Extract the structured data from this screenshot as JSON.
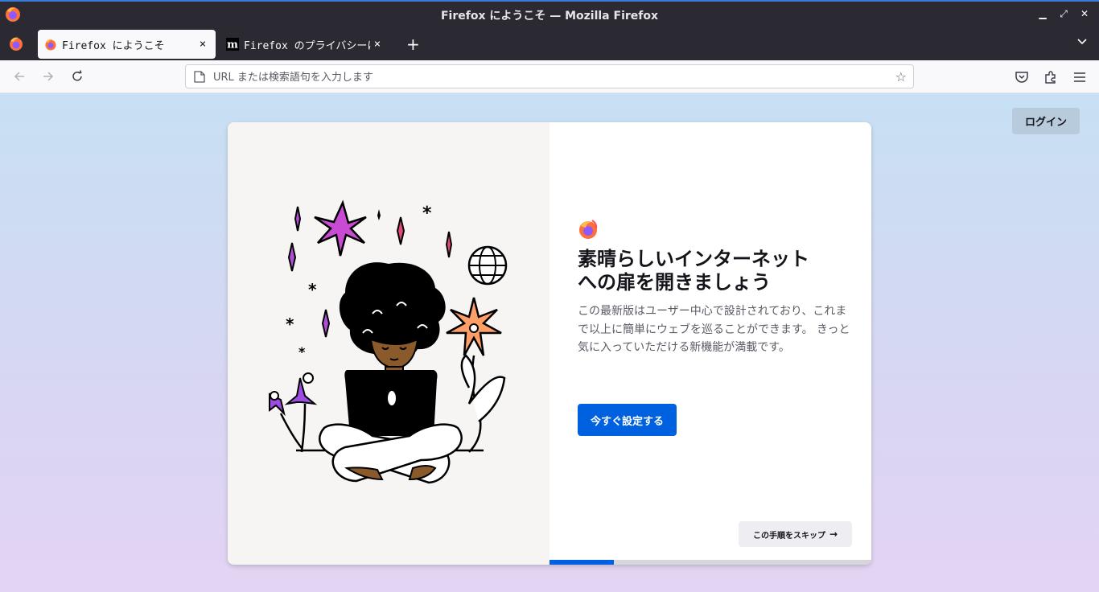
{
  "window": {
    "title": "Firefox にようこそ — Mozilla Firefox",
    "controls": [
      "minimize",
      "maximize",
      "close"
    ]
  },
  "tabs": [
    {
      "label": "Firefox にようこそ",
      "icon": "firefox-icon",
      "active": true,
      "close": "×"
    },
    {
      "label": "Firefox のプライバシーに関",
      "icon": "mozilla-m-icon",
      "active": false,
      "close": "×"
    }
  ],
  "tabbar": {
    "new_tab": "+",
    "list_all": "⌄"
  },
  "nav": {
    "back": "←",
    "forward": "→",
    "reload": "↻",
    "url_placeholder": "URL または検索語句を入力します",
    "bookmark_star": "☆"
  },
  "page": {
    "login_label": "ログイン",
    "heading_line1": "素晴らしいインターネット",
    "heading_line2": "への扉を開きましょう",
    "body": "この最新版はユーザー中心で設計されており、これまで以上に簡単にウェブを巡ることができます。 きっと気に入っていただける新機能が満載です。",
    "primary_button": "今すぐ設定する",
    "skip_button": "この手順をスキップ",
    "skip_arrow": "→",
    "progress": 0.2
  },
  "colors": {
    "accent": "#0061e0",
    "chrome_dark": "#2b2a33"
  }
}
